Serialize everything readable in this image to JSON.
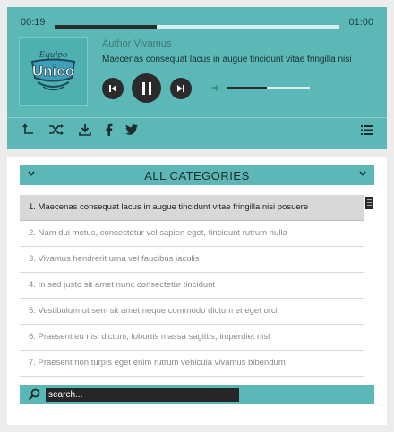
{
  "player": {
    "current_time": "00:19",
    "total_time": "01:00",
    "progress_fraction": 0.36,
    "volume_fraction": 0.48,
    "author": "Author Vivamus",
    "track_title": "Maecenas consequat lacus in augue tincidunt vitae fringilla nisi",
    "cover_script_text": "Equipo",
    "cover_logo_text": "Unico",
    "toolbar_icons": [
      "repeat-icon",
      "shuffle-icon",
      "download-icon",
      "facebook-icon",
      "twitter-icon",
      "playlist-icon"
    ]
  },
  "categories": {
    "label": "ALL CATEGORIES"
  },
  "tracks": [
    "1. Maecenas consequat lacus in augue tincidunt vitae fringilla nisi posuere",
    "2. Nam dui metus, consectetur vel sapien eget, tincidunt rutrum nulla",
    "3. Vivamus hendrerit urna vel faucibus iaculis",
    "4. In sed justo sit amet nunc consectetur tincidunt",
    "5. Vestibulum ut sem sit amet neque commodo dictum et eget orci",
    "6. Praesent eu nisi dictum, lobortis massa sagittis, imperdiet nisl",
    "7. Praesent non turpis eget enim rutrum vehicula vivamus bibendum"
  ],
  "active_track_index": 0,
  "search": {
    "placeholder": "search..."
  },
  "colors": {
    "accent": "#5bb8b6",
    "dark": "#2b2b2b",
    "background": "#ececec"
  }
}
